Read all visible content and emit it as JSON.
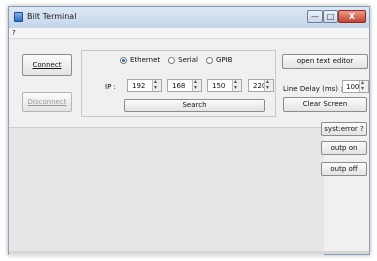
{
  "window": {
    "title": "Bilt Terminal"
  },
  "titlebar": {
    "minimize": "—",
    "maximize": "□",
    "close": "X"
  },
  "menu": {
    "items": [
      "?"
    ]
  },
  "buttons": {
    "connect": "Connect",
    "disconnect": "Disconnect",
    "search": "Search",
    "open_text_editor": "open text editor",
    "clear_screen": "Clear Screen",
    "syst_error": "syst:error ?",
    "outp_on": "outp on",
    "outp_off": "outp off"
  },
  "interface": {
    "options": [
      "Ethernet",
      "Serial",
      "GPIB"
    ],
    "selected": "Ethernet"
  },
  "ip": {
    "label": "IP :",
    "octets": [
      "192",
      "168",
      "150",
      "220"
    ]
  },
  "line_delay": {
    "label": "Line Delay (ms) :",
    "value": "100"
  },
  "colors": {
    "accent": "#2b63c4",
    "close_button": "#c7412e"
  },
  "icons": {
    "app": "terminal-app-icon"
  }
}
